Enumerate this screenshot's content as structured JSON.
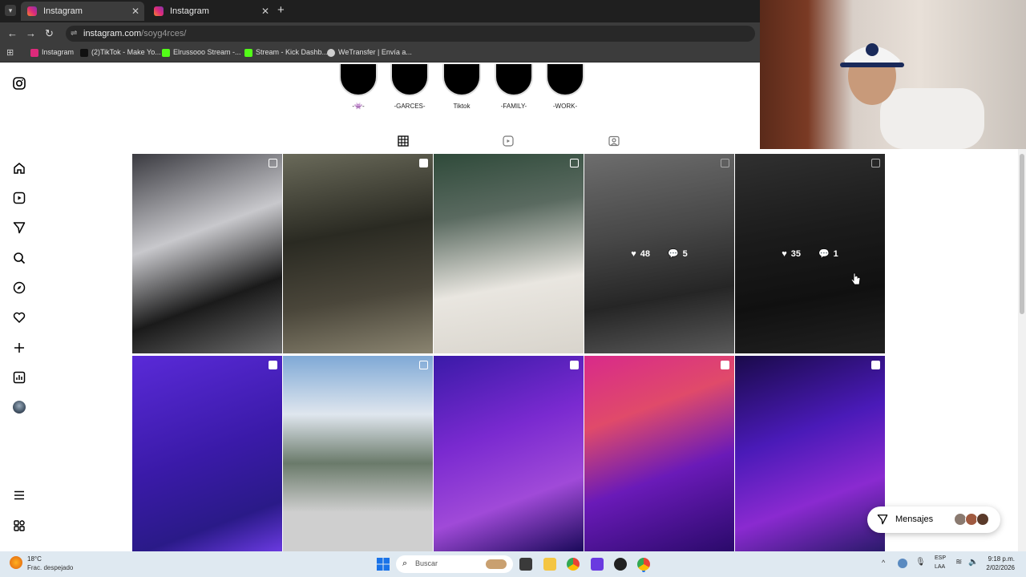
{
  "browser": {
    "tabs": [
      {
        "label": "Instagram",
        "active": true
      },
      {
        "label": "Instagram",
        "active": false
      }
    ],
    "url_host": "instagram.com",
    "url_path": "/soyg4rces/",
    "bookmarks": [
      {
        "label": "Instagram",
        "color": "#dd2a7b"
      },
      {
        "label": "(2)TikTok - Make Yo...",
        "color": "#111111"
      },
      {
        "label": "Elrussooo Stream -...",
        "color": "#53fc18"
      },
      {
        "label": "Stream - Kick Dashb...",
        "color": "#53fc18"
      },
      {
        "label": "WeTransfer | Envía a...",
        "color": "#cfcfcf"
      }
    ]
  },
  "highlights": [
    {
      "label": "-👾-"
    },
    {
      "label": "-GARCES-"
    },
    {
      "label": "Tiktok"
    },
    {
      "label": "-FAMILY-"
    },
    {
      "label": "-WORK-"
    }
  ],
  "posts": [
    {
      "bg": "linear-gradient(160deg,#3a3a40,#c8c8cc 40%,#1a1a1a 70%,#6b6b6b)",
      "badge": "multi",
      "likes": "",
      "comments": ""
    },
    {
      "bg": "linear-gradient(170deg,#6a6a5a,#2a2a22 40%,#4a463a 70%,#8a8470)",
      "badge": "reel",
      "likes": "",
      "comments": ""
    },
    {
      "bg": "linear-gradient(170deg,#2f4a3a,#5a6a60 30%,#e9e6e0 65%,#d8d4cc)",
      "badge": "multi",
      "likes": "",
      "comments": ""
    },
    {
      "bg": "linear-gradient(170deg,#a8a8a8,#6e6e6e 40%,#3a3a3a 70%,#8a8a8a)",
      "badge": "multi",
      "likes": "48",
      "comments": "5"
    },
    {
      "bg": "linear-gradient(170deg,#4a4a4a,#2a2a2a 40%,#1a1a1a 70%,#333)",
      "badge": "multi",
      "likes": "35",
      "comments": "1"
    },
    {
      "bg": "linear-gradient(160deg,#5a2ad8,#3a1aa8 50%,#2a1a88 80%,#6a3ae0)",
      "badge": "reel",
      "likes": "",
      "comments": ""
    },
    {
      "bg": "linear-gradient(180deg,#7fa9d6,#dfe6ee 30%,#6a7a6a 55%,#cfcfcf 80%)",
      "badge": "multi",
      "likes": "",
      "comments": ""
    },
    {
      "bg": "linear-gradient(160deg,#3a1aa8,#7a2ad0 40%,#a04ad8 70%,#1a0a5a)",
      "badge": "reel",
      "likes": "",
      "comments": ""
    },
    {
      "bg": "linear-gradient(160deg,#d82a8a,#e04a6a 30%,#6a1ab8 60%,#2a0a6a)",
      "badge": "reel",
      "likes": "",
      "comments": ""
    },
    {
      "bg": "linear-gradient(160deg,#1a0a4a,#4a1ab8 40%,#8a2ad0 70%,#2a1a6a)",
      "badge": "reel",
      "likes": "",
      "comments": ""
    }
  ],
  "messages": {
    "label": "Mensajes"
  },
  "taskbar": {
    "weather_temp": "18°C",
    "weather_desc": "Frac. despejado",
    "search_placeholder": "Buscar",
    "lang_1": "ESP",
    "lang_2": "LAA",
    "time": "9:18 p.m.",
    "date": "2/02/2026"
  },
  "colors": {
    "instagram_brand": "#dd2a7b",
    "chrome_dark": "#1f1f1f",
    "taskbar": "#dfe9f1"
  }
}
